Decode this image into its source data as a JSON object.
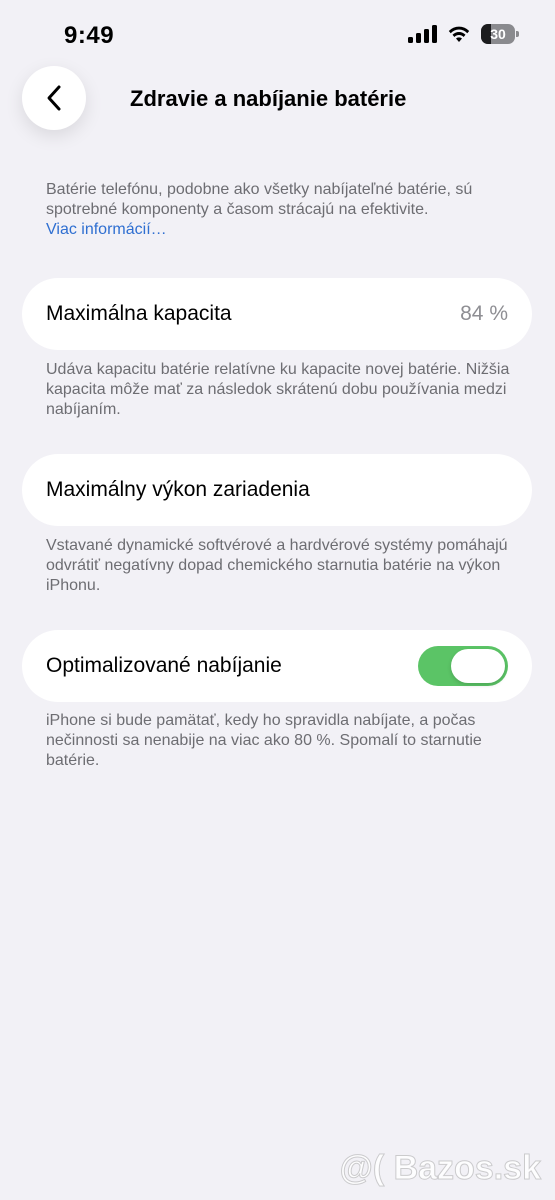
{
  "status_bar": {
    "time": "9:49",
    "battery_level": "30",
    "battery_percent": 30
  },
  "nav": {
    "title": "Zdravie a nabíjanie batérie"
  },
  "intro": {
    "text": "Batérie telefónu, podobne ako všetky nabíjateľné batérie, sú spotrebné komponenty a časom strácajú na efektivite.",
    "link": "Viac informácií…"
  },
  "max_capacity": {
    "label": "Maximálna kapacita",
    "value": "84 %",
    "note": "Udáva kapacitu batérie relatívne ku kapacite novej batérie. Nižšia kapacita môže mať za následok skrátenú dobu používania medzi nabíjaním."
  },
  "peak_performance": {
    "label": "Maximálny výkon zariadenia",
    "note": "Vstavané dynamické softvérové a hardvérové systémy pomáhajú odvrátiť negatívny dopad chemického starnutia batérie na výkon iPhonu."
  },
  "optimized_charging": {
    "label": "Optimalizované nabíjanie",
    "enabled": true,
    "note": "iPhone si bude pamätať, kedy ho spravidla nabíjate, a počas nečinnosti sa nenabije na viac ako 80 %. Spomalí to starnutie batérie."
  },
  "watermark": "@( Bazos.sk",
  "colors": {
    "background": "#f2f1f6",
    "link": "#2f6fd1",
    "toggle_on": "#5bc466",
    "secondary_text": "#6d6d72"
  }
}
